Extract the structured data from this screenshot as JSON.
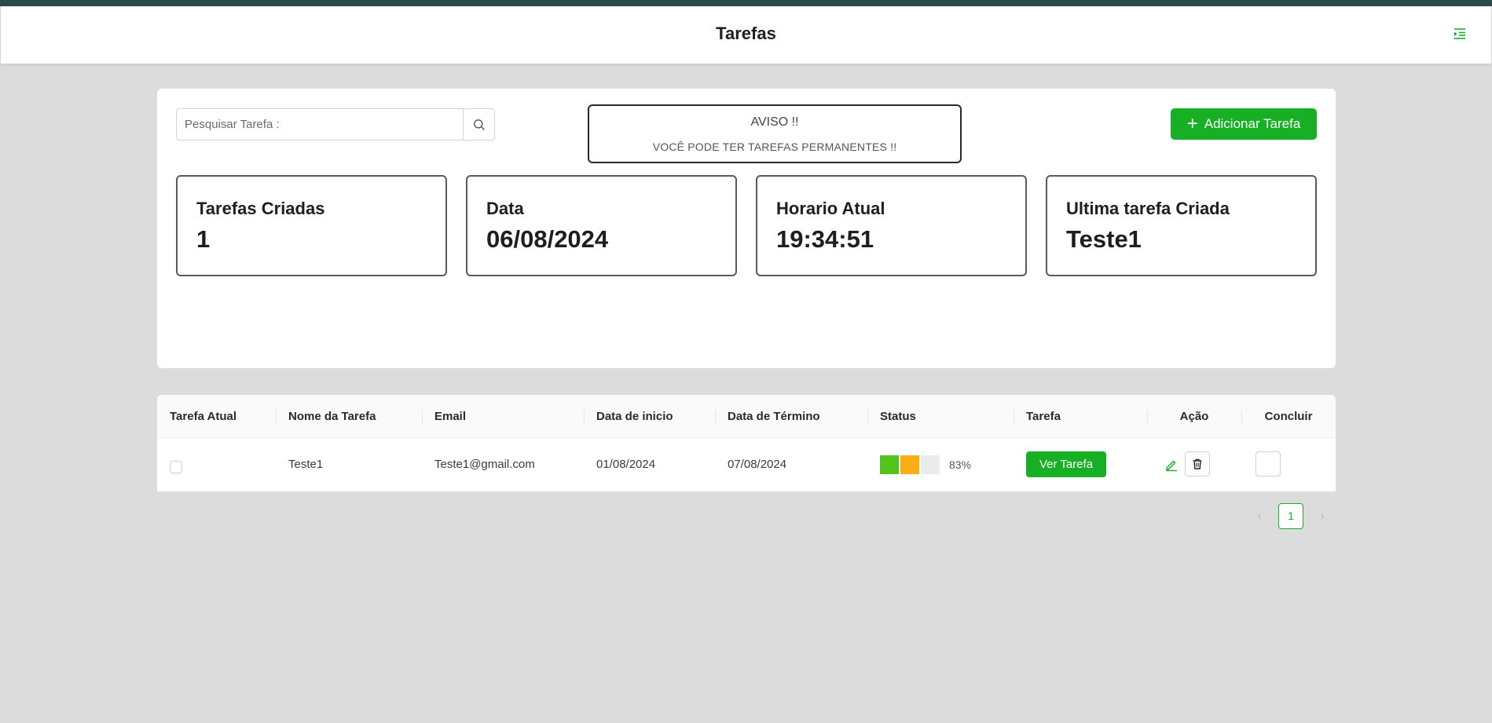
{
  "header": {
    "title": "Tarefas",
    "menu_icon": "menu-unfold-icon"
  },
  "search": {
    "placeholder": "Pesquisar Tarefa :",
    "value": ""
  },
  "aviso": {
    "title": "AVISO !!",
    "message": "VOCÊ PODE TER TAREFAS PERMANENTES !!"
  },
  "add_button": {
    "label": "Adicionar Tarefa"
  },
  "cards": [
    {
      "label": "Tarefas Criadas",
      "value": "1"
    },
    {
      "label": "Data",
      "value": "06/08/2024"
    },
    {
      "label": "Horario Atual",
      "value": "19:34:51"
    },
    {
      "label": "Ultima tarefa Criada",
      "value": "Teste1"
    }
  ],
  "table": {
    "columns": [
      "Tarefa Atual",
      "Nome da Tarefa",
      "Email",
      "Data de inicio",
      "Data de Término",
      "Status",
      "Tarefa",
      "Ação",
      "Concluir"
    ],
    "rows": [
      {
        "current": false,
        "name": "Teste1",
        "email": "Teste1@gmail.com",
        "start": "01/08/2024",
        "end": "07/08/2024",
        "status_pct": "83%",
        "status_colors": [
          "#52c41a",
          "#faad14",
          "#ebebeb"
        ],
        "view_label": "Ver Tarefa"
      }
    ]
  },
  "pagination": {
    "current": "1"
  },
  "colors": {
    "accent": "#17b025",
    "topbar": "#2c4a48",
    "background": "#dcdcdc"
  }
}
